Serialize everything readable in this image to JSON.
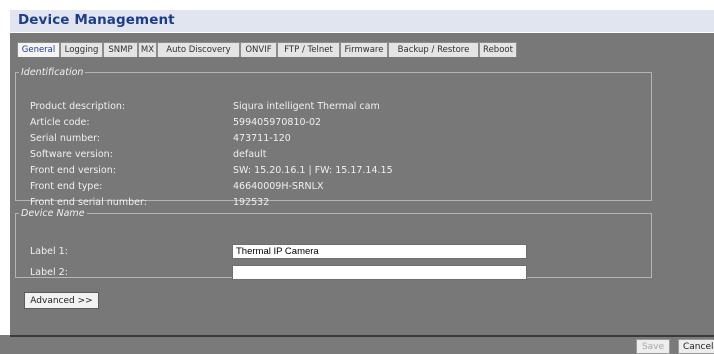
{
  "header": {
    "title": "Device Management"
  },
  "tabs": [
    {
      "label": "General",
      "active": true
    },
    {
      "label": "Logging"
    },
    {
      "label": "SNMP"
    },
    {
      "label": "MX"
    },
    {
      "label": "Auto Discovery"
    },
    {
      "label": "ONVIF"
    },
    {
      "label": "FTP / Telnet"
    },
    {
      "label": "Firmware"
    },
    {
      "label": "Backup / Restore"
    },
    {
      "label": "Reboot"
    }
  ],
  "identification": {
    "legend": "Identification",
    "rows": [
      {
        "label": "Product description:",
        "value": "Siqura intelligent Thermal cam"
      },
      {
        "label": "Article code:",
        "value": "599405970810-02"
      },
      {
        "label": "Serial number:",
        "value": "473711-120"
      },
      {
        "label": "Software version:",
        "value": "default"
      },
      {
        "label": "Front end version:",
        "value": "SW: 15.20.16.1 | FW: 15.17.14.15"
      },
      {
        "label": "Front end type:",
        "value": "46640009H-SRNLX"
      },
      {
        "label": "Front end serial number:",
        "value": "192532"
      }
    ]
  },
  "device_name": {
    "legend": "Device Name",
    "label1": {
      "label": "Label 1:",
      "value": "Thermal IP Camera"
    },
    "label2": {
      "label": "Label 2:",
      "value": ""
    }
  },
  "advanced_button": "Advanced >>",
  "footer": {
    "save": "Save",
    "cancel": "Cancel"
  },
  "colors": {
    "header_bg": "#e1e5ef",
    "title": "#1e3d8c",
    "panel_bg": "#787878"
  }
}
